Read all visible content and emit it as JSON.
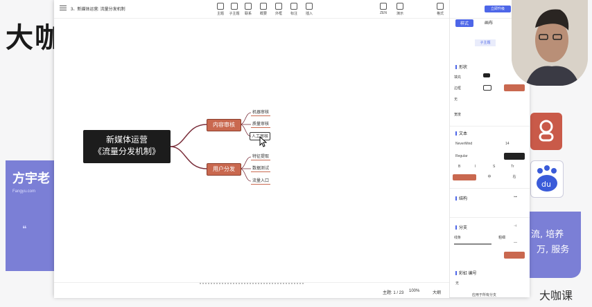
{
  "background": {
    "brand_big": "大咖",
    "left_card": {
      "name": "方宇老",
      "subtitle": "Fangyu.com",
      "quote": "❝"
    },
    "right_card": {
      "line1": "流, 培养",
      "line2": "万, 服务"
    },
    "bottom_brand": "大咖课",
    "colors": {
      "card": "#7b7fd6",
      "logo_red": "#c95a49"
    }
  },
  "window": {
    "doc_title": "3、新媒体运营: 流量分发机制",
    "toolbar": [
      "主题",
      "子主题",
      "联系",
      "概要",
      "外框",
      "标注",
      "插入"
    ],
    "toolbar_right": [
      "ZEN",
      "演示"
    ],
    "panel_toggle": "格式"
  },
  "mindmap": {
    "root_line1": "新媒体运营",
    "root_line2": "《流量分发机制》",
    "branches": [
      {
        "label": "内容审核",
        "children": [
          "机器审核",
          "质量审核",
          "人工审核"
        ]
      },
      {
        "label": "用户分发",
        "children": [
          "特征提取",
          "数据测试",
          "流量入口"
        ]
      }
    ],
    "colors": {
      "root": "#1c1c1c",
      "branch": "#c9684f",
      "line": "#7a2e3a"
    }
  },
  "status": {
    "topics": "主题: 1 / 23",
    "zoom": "100%",
    "size_label": "大纲"
  },
  "panel": {
    "upgrade": "立即升级",
    "tabs": [
      "样式",
      "画布"
    ],
    "sub_tab": "子主题",
    "shape_title": "形状",
    "fill_label": "填充",
    "border_label": "边框",
    "none_label": "无",
    "layout_label": "宽度",
    "text_title": "文本",
    "font_name": "NeverMind",
    "font_size": "14",
    "font_weight": "Regular",
    "format_buttons": [
      "B",
      "I",
      "S",
      "Tr"
    ],
    "align_buttons": [
      "",
      "左",
      "中",
      "右"
    ],
    "struct_title": "结构",
    "branch_title": "分支",
    "branch_label1": "线条",
    "branch_label2": "粗细",
    "rainbow_title": "彩虹 编号",
    "bottom_value": "无",
    "bottom_note": "应用于所有分支",
    "colors": {
      "accent": "#4d66e8",
      "swatch_orange": "#c9684f",
      "swatch_dark": "#222222"
    }
  }
}
